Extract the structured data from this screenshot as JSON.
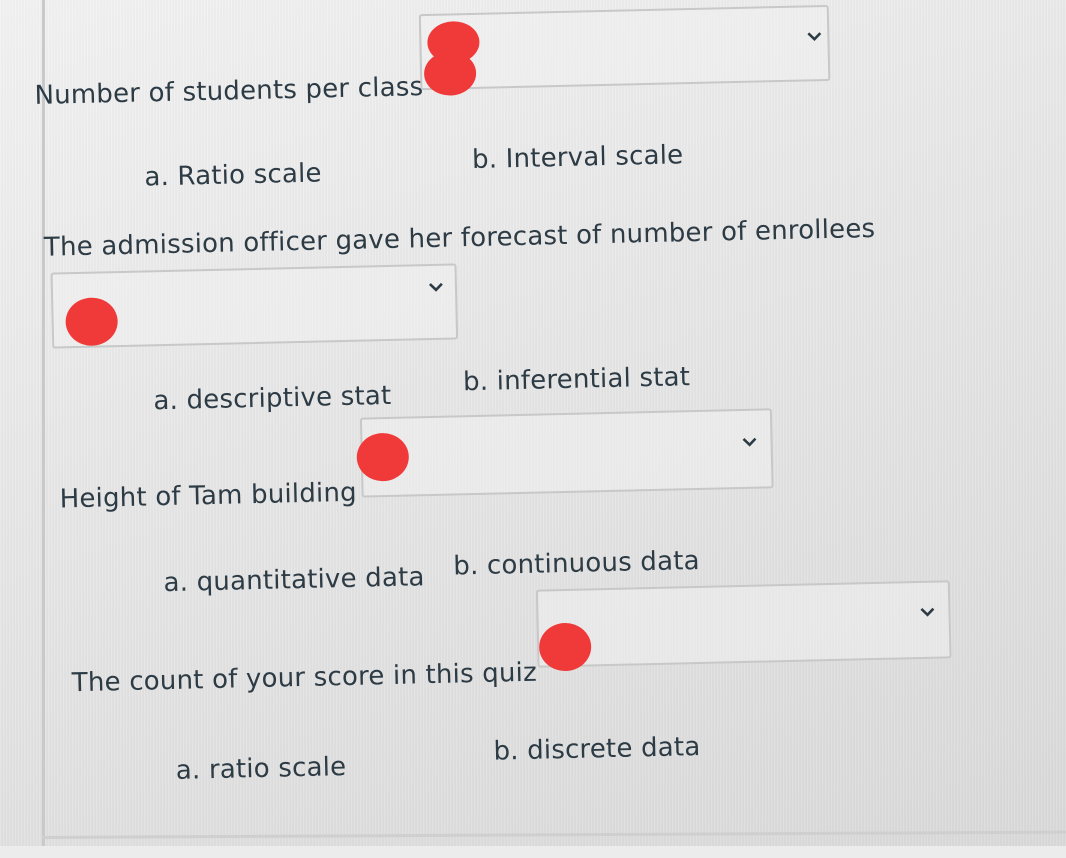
{
  "questions": [
    {
      "prompt": "Number of students per class",
      "option_a": "a. Ratio scale",
      "option_b": "b. Interval scale",
      "selected_value": ""
    },
    {
      "prompt": "The admission officer gave her forecast of number of enrollees",
      "option_a": "a. descriptive stat",
      "option_b": "b. inferential  stat",
      "selected_value": ""
    },
    {
      "prompt": "Height of Tam building",
      "option_a": "a. quantitative data",
      "option_b": "b. continuous data",
      "selected_value": ""
    },
    {
      "prompt": "The count of your score in this quiz",
      "option_a": "a. ratio scale",
      "option_b": "b. discrete data",
      "selected_value": ""
    }
  ],
  "icons": {
    "dropdown": "chevron-down-icon",
    "redaction": "red-dot"
  },
  "colors": {
    "text": "#2d3b45",
    "select_border": "#c8c8c8",
    "redaction": "#f03a3a"
  }
}
